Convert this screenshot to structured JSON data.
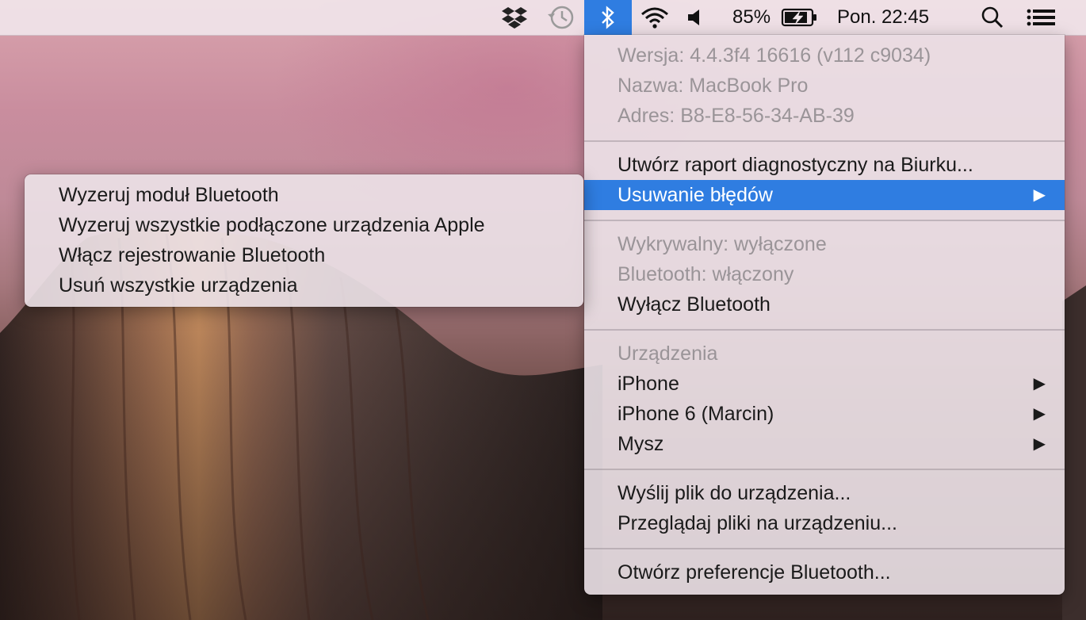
{
  "menubar": {
    "icons": [
      "dropbox-icon",
      "time-machine-icon",
      "bluetooth-icon",
      "wifi-icon",
      "volume-icon"
    ],
    "battery_percent": "85%",
    "clock": "Pon. 22:45",
    "right_icons": [
      "spotlight-search-icon",
      "notification-center-icon"
    ]
  },
  "bluetooth_menu": {
    "info": {
      "version": "Wersja: 4.4.3f4 16616 (v112 c9034)",
      "name": "Nazwa: MacBook Pro",
      "address": "Adres: B8-E8-56-34-AB-39"
    },
    "diagnostic_report": "Utwórz raport diagnostyczny na Biurku...",
    "debug": "Usuwanie błędów",
    "discoverable": "Wykrywalny: wyłączone",
    "bluetooth_state": "Bluetooth: włączony",
    "turn_off": "Wyłącz Bluetooth",
    "devices_header": "Urządzenia",
    "devices": [
      {
        "name": "iPhone"
      },
      {
        "name": "iPhone 6 (Marcin)"
      },
      {
        "name": "Mysz"
      }
    ],
    "send_file": "Wyślij plik do urządzenia...",
    "browse_files": "Przeglądaj pliki na urządzeniu...",
    "open_prefs": "Otwórz preferencje Bluetooth...",
    "submenu_arrow": "▶"
  },
  "debug_submenu": {
    "items": [
      "Wyzeruj moduł Bluetooth",
      "Wyzeruj wszystkie podłączone urządzenia Apple",
      "Włącz rejestrowanie Bluetooth",
      "Usuń wszystkie urządzenia"
    ]
  },
  "colors": {
    "highlight": "#2f7de1",
    "menu_text": "#1a1a1a",
    "disabled_text": "#9a9498"
  }
}
